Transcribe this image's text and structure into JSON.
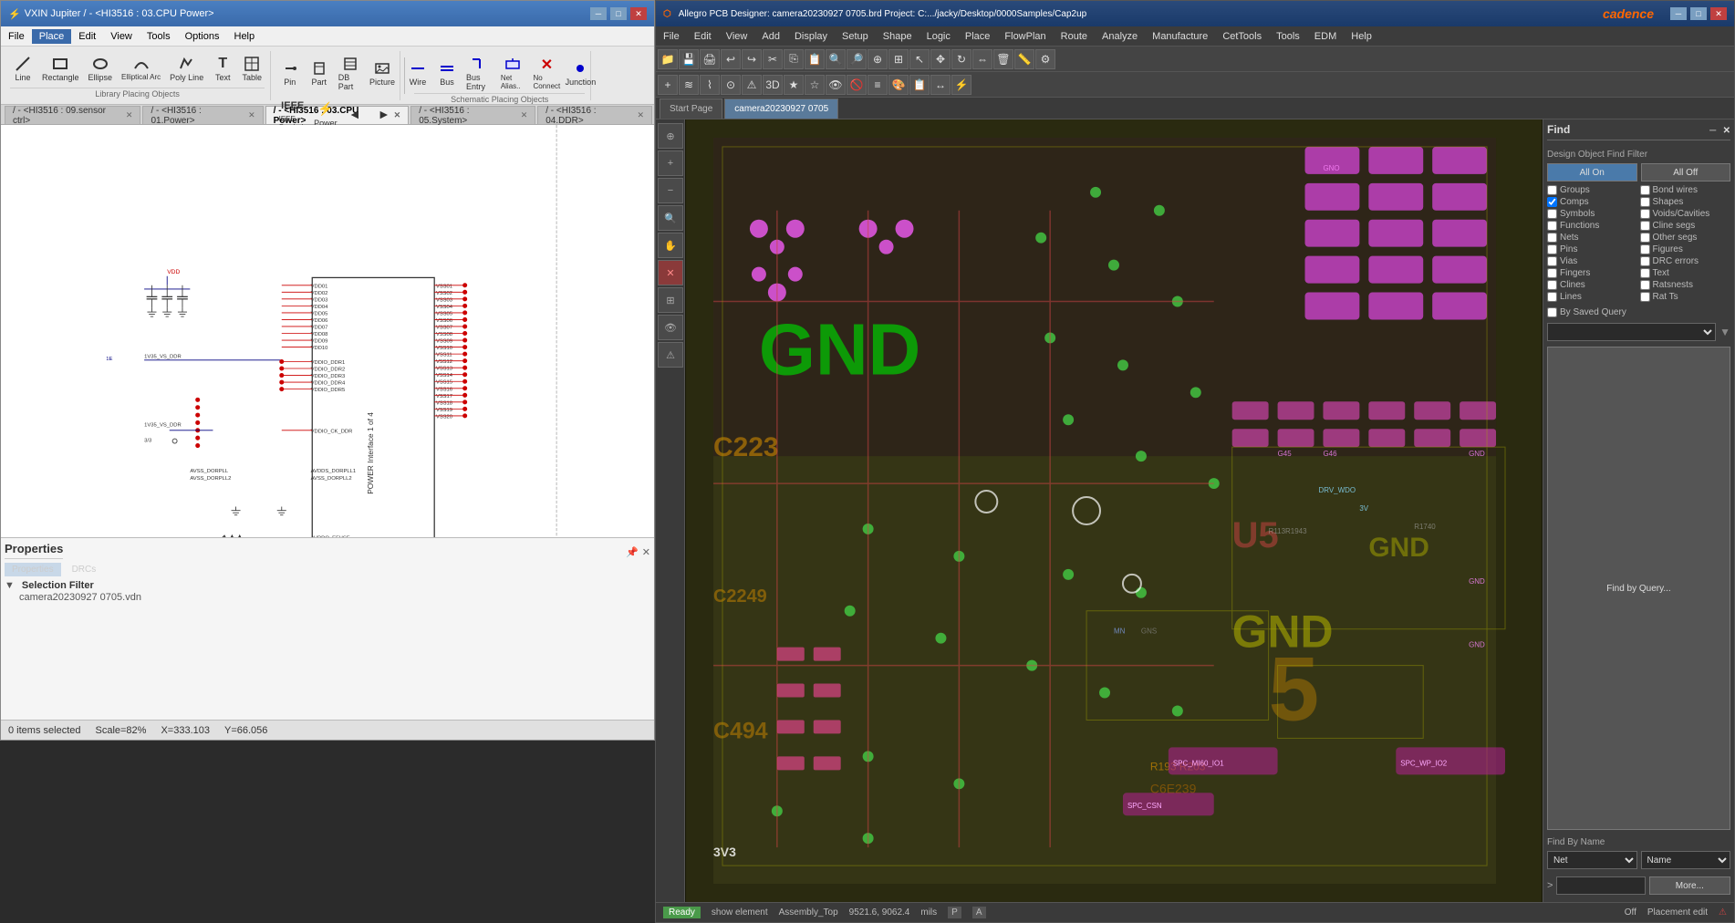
{
  "left_app": {
    "titlebar": "VXIN Jupiter / - <HI3516 : 03.CPU Power>",
    "title_icon": "⚡",
    "menubar": [
      "File",
      "Place",
      "Edit",
      "View",
      "Tools",
      "Options",
      "Help"
    ],
    "active_menu": "Place",
    "toolbar": {
      "drawing_tools": [
        {
          "name": "line",
          "label": "Line",
          "icon": "/"
        },
        {
          "name": "rectangle",
          "label": "Rectangle",
          "icon": "□"
        },
        {
          "name": "ellipse",
          "label": "Ellipse",
          "icon": "○"
        },
        {
          "name": "elliptical-arc",
          "label": "Elliptical Arc",
          "icon": "◠"
        },
        {
          "name": "poly-line",
          "label": "Poly Line",
          "icon": "∧"
        },
        {
          "name": "text",
          "label": "Text",
          "icon": "T"
        },
        {
          "name": "table",
          "label": "Table",
          "icon": "⊞"
        }
      ],
      "library_tools": [
        {
          "name": "pin",
          "label": "Pin",
          "icon": "⊢"
        },
        {
          "name": "part",
          "label": "Part",
          "icon": "▣"
        },
        {
          "name": "db-part",
          "label": "DB Part",
          "icon": "▤"
        },
        {
          "name": "picture",
          "label": "Picture",
          "icon": "🖼"
        },
        {
          "name": "ieee-symbol",
          "label": "IEEE Symbol",
          "icon": "≈"
        },
        {
          "name": "power",
          "label": "Power",
          "icon": "⚡"
        },
        {
          "name": "left-arrow",
          "label": "",
          "icon": "◄"
        },
        {
          "name": "right-arrow",
          "label": "",
          "icon": "►"
        }
      ],
      "schematic_tools": [
        {
          "name": "wire",
          "label": "Wire",
          "icon": "—"
        },
        {
          "name": "bus",
          "label": "Bus",
          "icon": "≡"
        },
        {
          "name": "bus-entry",
          "label": "Bus Entry",
          "icon": "⌐"
        },
        {
          "name": "net-alias",
          "label": "Net Alias..",
          "icon": "≙"
        },
        {
          "name": "no-connect",
          "label": "No Connect",
          "icon": "✕"
        },
        {
          "name": "junction",
          "label": "Junction",
          "icon": "●"
        }
      ]
    },
    "toolbar_sections": {
      "library": "Library Placing Objects",
      "schematic": "Schematic Placing Objects"
    },
    "tabs": [
      {
        "id": "tab1",
        "label": "/ - <HI3516 : 09.sensor ctrl>"
      },
      {
        "id": "tab2",
        "label": "/ - <HI3516 : 01.Power>"
      },
      {
        "id": "tab3",
        "label": "/ - <HI3516 : 03.CPU Power>",
        "active": true
      },
      {
        "id": "tab4",
        "label": "/ - <HI3516 : 05.System>"
      },
      {
        "id": "tab5",
        "label": "/ - <HI3516 : 04.DDR>"
      }
    ],
    "properties": {
      "title": "Properties",
      "filter_label": "Selection Filter",
      "tabs": [
        "Properties",
        "DRCs"
      ],
      "file": "camera20230927 0705.vdn"
    },
    "statusbar": {
      "items_selected": "0 items selected",
      "scale": "Scale=82%",
      "x_coord": "X=333.103",
      "y_coord": "Y=66.056"
    }
  },
  "right_app": {
    "titlebar": "Allegro PCB Designer: camera20230927 0705.brd  Project: C:.../jacky/Desktop/0000Samples/Cap2up",
    "brand": "cadence",
    "menubar": [
      "File",
      "Edit",
      "View",
      "Add",
      "Display",
      "Setup",
      "Shape",
      "Logic",
      "Place",
      "FlowPlan",
      "Route",
      "Analyze",
      "Manufacture",
      "CetTools",
      "Tools",
      "EDM",
      "Help"
    ],
    "tabs": [
      {
        "id": "start",
        "label": "Start Page"
      },
      {
        "id": "cam",
        "label": "camera20230927 0705",
        "active": true
      }
    ],
    "find_panel": {
      "title": "Find",
      "subtitle": "Design Object Find Filter",
      "all_on": "All On",
      "all_off": "All Off",
      "checkboxes": [
        {
          "id": "groups",
          "label": "Groups",
          "checked": false
        },
        {
          "id": "bond-wires",
          "label": "Bond wires",
          "checked": false
        },
        {
          "id": "comps",
          "label": "Comps",
          "checked": true
        },
        {
          "id": "shapes",
          "label": "Shapes",
          "checked": false
        },
        {
          "id": "symbols",
          "label": "Symbols",
          "checked": false
        },
        {
          "id": "voids-cavities",
          "label": "Voids/Cavities",
          "checked": false
        },
        {
          "id": "functions",
          "label": "Functions",
          "checked": false
        },
        {
          "id": "cline-segs",
          "label": "Cline segs",
          "checked": false
        },
        {
          "id": "nets",
          "label": "Nets",
          "checked": false
        },
        {
          "id": "other-segs",
          "label": "Other segs",
          "checked": false
        },
        {
          "id": "pins",
          "label": "Pins",
          "checked": false
        },
        {
          "id": "figures",
          "label": "Figures",
          "checked": false
        },
        {
          "id": "vias",
          "label": "Vias",
          "checked": false
        },
        {
          "id": "drc-errors",
          "label": "DRC errors",
          "checked": false
        },
        {
          "id": "fingers",
          "label": "Fingers",
          "checked": false
        },
        {
          "id": "text",
          "label": "Text",
          "checked": false
        },
        {
          "id": "clines",
          "label": "Clines",
          "checked": false
        },
        {
          "id": "ratsnests",
          "label": "Ratsnests",
          "checked": false
        },
        {
          "id": "lines",
          "label": "Lines",
          "checked": false
        },
        {
          "id": "rat-ts",
          "label": "Rat Ts",
          "checked": false
        }
      ],
      "by_saved_query": "By Saved Query",
      "find_by_query": "Find by Query...",
      "find_by_name": "Find By Name",
      "name_type": "Net",
      "name_filter": "Name",
      "more_btn": "More...",
      "gt_label": ">"
    },
    "statusbar": {
      "ready": "Ready",
      "show_element": "show element",
      "layer": "Assembly_Top",
      "coords": "9521.6, 9062.4",
      "units": "mils",
      "p_label": "P",
      "a_label": "A",
      "off_label": "Off",
      "placement_edit": "Placement edit"
    }
  }
}
